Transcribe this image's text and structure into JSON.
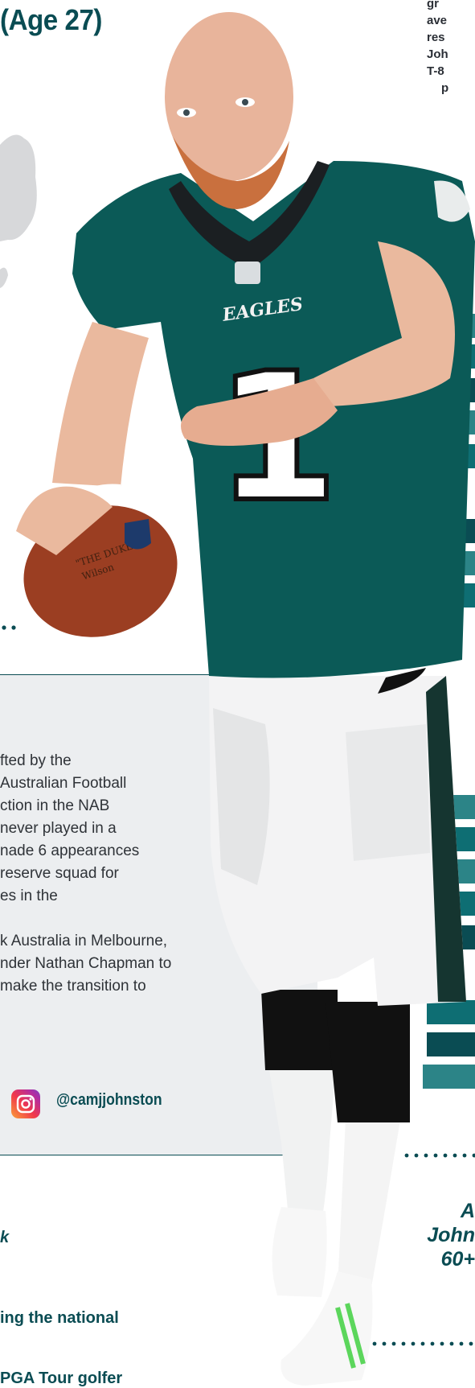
{
  "header": {
    "title_fragment": "(Age 27)"
  },
  "top_right_text": [
    "gr",
    "ave",
    "res",
    "Joh",
    "T-8",
    "p"
  ],
  "bio": {
    "paragraph_1": [
      "fted by the",
      "Australian Football",
      "ction in the NAB",
      "never played in a",
      "nade 6 appearances",
      "reserve squad for",
      "es in the"
    ],
    "paragraph_2": [
      "k Australia in Melbourne,",
      "nder Nathan Chapman to",
      "make the transition to"
    ]
  },
  "social": {
    "icon": "instagram-icon",
    "handle": "@camjjohnston"
  },
  "list": {
    "item_1": "k",
    "item_2": "ing the national",
    "item_3": "PGA Tour golfer"
  },
  "quote_fragment": [
    "A",
    "John",
    "60+"
  ],
  "player": {
    "jersey_number": "1",
    "team_wordmark": "EAGLES",
    "football_text_1": "\"THE DUKE\"",
    "football_text_2": "Wilson"
  },
  "colors": {
    "brand_teal": "#0a4c53",
    "jersey_green": "#0b5a57",
    "panel_gray": "#eceef0"
  }
}
